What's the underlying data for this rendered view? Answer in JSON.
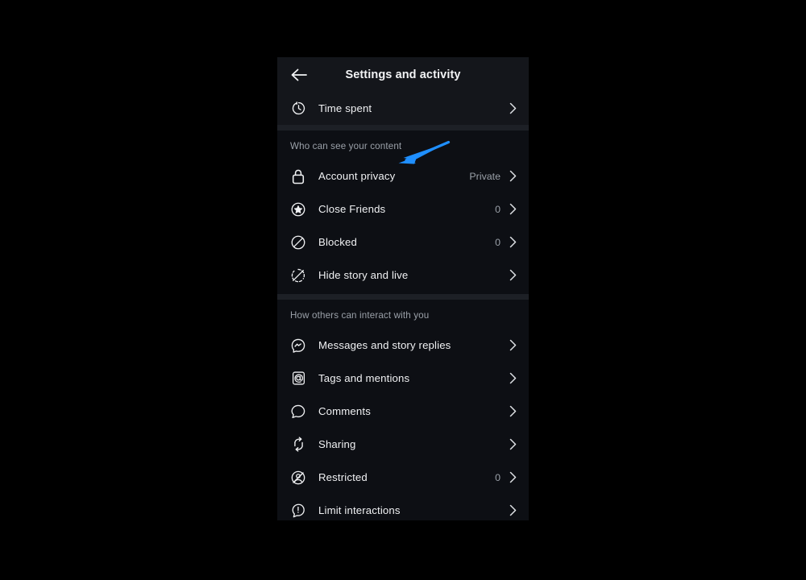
{
  "header": {
    "back_icon": "back-arrow-icon",
    "title": "Settings and activity"
  },
  "top_section": {
    "items": [
      {
        "icon": "clock-timer-icon",
        "label": "Time spent",
        "value": "",
        "chevron": "chevron-right-icon"
      }
    ]
  },
  "sections": [
    {
      "title": "Who can see your content",
      "items": [
        {
          "icon": "lock-icon",
          "label": "Account privacy",
          "value": "Private",
          "chevron": "chevron-right-icon"
        },
        {
          "icon": "star-circle-icon",
          "label": "Close Friends",
          "value": "0",
          "chevron": "chevron-right-icon"
        },
        {
          "icon": "block-circle-icon",
          "label": "Blocked",
          "value": "0",
          "chevron": "chevron-right-icon"
        },
        {
          "icon": "hide-story-icon",
          "label": "Hide story and live",
          "value": "",
          "chevron": "chevron-right-icon"
        }
      ]
    },
    {
      "title": "How others can interact with you",
      "items": [
        {
          "icon": "messenger-icon",
          "label": "Messages and story replies",
          "value": "",
          "chevron": "chevron-right-icon"
        },
        {
          "icon": "at-mention-icon",
          "label": "Tags and mentions",
          "value": "",
          "chevron": "chevron-right-icon"
        },
        {
          "icon": "comment-bubble-icon",
          "label": "Comments",
          "value": "",
          "chevron": "chevron-right-icon"
        },
        {
          "icon": "share-repost-icon",
          "label": "Sharing",
          "value": "",
          "chevron": "chevron-right-icon"
        },
        {
          "icon": "restricted-icon",
          "label": "Restricted",
          "value": "0",
          "chevron": "chevron-right-icon"
        },
        {
          "icon": "limit-exclaim-icon",
          "label": "Limit interactions",
          "value": "",
          "chevron": "chevron-right-icon"
        }
      ]
    }
  ],
  "annotation": {
    "type": "arrow",
    "color": "#1f8fff",
    "points_to": "Account privacy"
  },
  "colors": {
    "page_background": "#000000",
    "panel_background": "#0d0f14",
    "header_background": "#14161b",
    "band": "#1d2026",
    "primary_text": "#f0f1f3",
    "secondary_text": "#9aa0a8",
    "accent": "#1f8fff"
  }
}
